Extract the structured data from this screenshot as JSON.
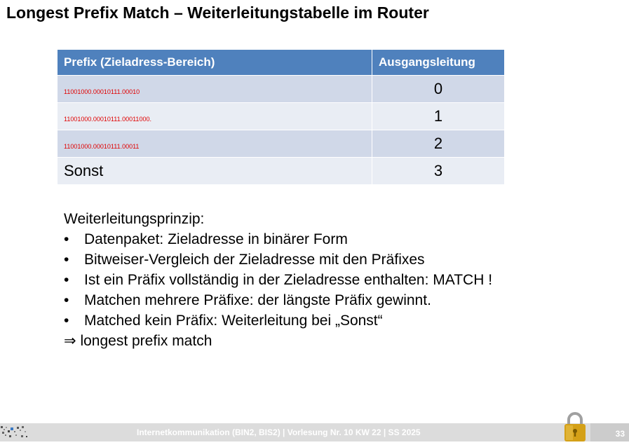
{
  "slide": {
    "title": "Longest Prefix Match – Weiterleitungstabelle im Router"
  },
  "table": {
    "headers": [
      "Prefix (Zieladress-Bereich)",
      "Ausgangsleitung"
    ],
    "rows": [
      {
        "prefix": "11001000.00010111.00010",
        "port": "0"
      },
      {
        "prefix": "11001000.00010111.00011000.",
        "port": "1"
      },
      {
        "prefix": "11001000.00010111.00011",
        "port": "2"
      },
      {
        "prefix": "Sonst",
        "port": "3"
      }
    ]
  },
  "body": {
    "heading": "Weiterleitungsprinzip:",
    "bullet": "•",
    "bullets": [
      "Datenpaket: Zieladresse in binärer Form",
      "Bitweiser-Vergleich der Zieladresse mit den Präfixes",
      "Ist ein Präfix vollständig in der Zieladresse enthalten: MATCH !",
      "Matchen mehrere Präfixe: der längste Präfix gewinnt.",
      "Matched kein Präfix: Weiterleitung bei „Sonst“"
    ],
    "implies_symbol": "⇒",
    "conclusion": "longest prefix match"
  },
  "footer": {
    "text": "Internetkommunikation (BIN2, BIS2) | Vorlesung Nr. 10 KW 22 | SS 2025",
    "page_number": "33",
    "logo_icon": "university-logo-icon",
    "lock_icon": "padlock-icon"
  },
  "colors": {
    "header_bg": "#4f81bd",
    "row_odd": "#d0d8e8",
    "row_even": "#e9edf4",
    "prefix_text": "#e00000",
    "lock_gold": "#d4a017"
  }
}
